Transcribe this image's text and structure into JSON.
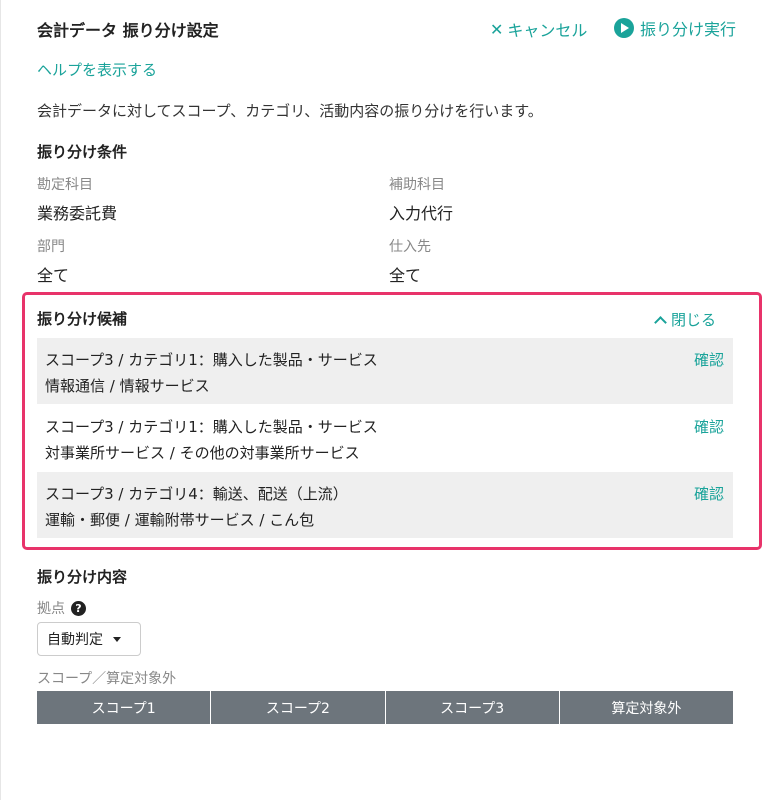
{
  "header": {
    "title": "会計データ 振り分け設定",
    "cancel_label": "キャンセル",
    "run_label": "振り分け実行"
  },
  "help_link": "ヘルプを表示する",
  "description": "会計データに対してスコープ、カテゴリ、活動内容の振り分けを行います。",
  "conditions": {
    "title": "振り分け条件",
    "account_label": "勘定科目",
    "account_value": "業務委託費",
    "sub_account_label": "補助科目",
    "sub_account_value": "入力代行",
    "department_label": "部門",
    "department_value": "全て",
    "supplier_label": "仕入先",
    "supplier_value": "全て"
  },
  "candidates": {
    "title": "振り分け候補",
    "close_label": "閉じる",
    "confirm_label": "確認",
    "items": [
      {
        "line1": "スコープ3 / カテゴリ1：購入した製品・サービス",
        "line2": "情報通信 / 情報サービス"
      },
      {
        "line1": "スコープ3 / カテゴリ1：購入した製品・サービス",
        "line2": "対事業所サービス / その他の対事業所サービス"
      },
      {
        "line1": "スコープ3 / カテゴリ4：輸送、配送（上流）",
        "line2": "運輸・郵便 / 運輸附帯サービス / こん包"
      }
    ]
  },
  "content": {
    "title": "振り分け内容",
    "location_label": "拠点",
    "location_select": "自動判定",
    "scope_label": "スコープ／算定対象外",
    "scope_tabs": [
      "スコープ1",
      "スコープ2",
      "スコープ3",
      "算定対象外"
    ]
  },
  "colors": {
    "accent": "#1aa39a",
    "highlight_border": "#e8336a",
    "table_header": "#6d757c"
  }
}
